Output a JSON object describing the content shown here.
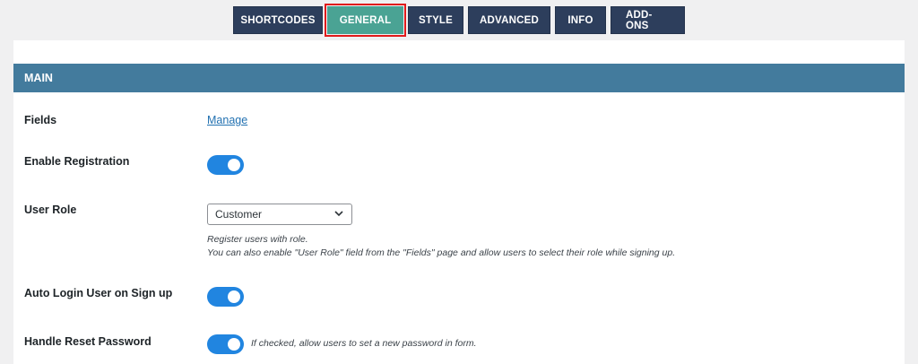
{
  "tabs": [
    {
      "label": "SHORTCODES"
    },
    {
      "label": "GENERAL"
    },
    {
      "label": "STYLE"
    },
    {
      "label": "ADVANCED"
    },
    {
      "label": "INFO"
    },
    {
      "label": "ADD-ONS"
    }
  ],
  "active_tab": "GENERAL",
  "section": {
    "title": "MAIN"
  },
  "fields": {
    "label": "Fields",
    "link": "Manage"
  },
  "enable_registration": {
    "label": "Enable Registration",
    "checked": true
  },
  "user_role": {
    "label": "User Role",
    "selected": "Customer",
    "description_line1": "Register users with role.",
    "description_line2": "You can also enable \"User Role\" field from the \"Fields\" page and allow users to select their role while signing up."
  },
  "auto_login": {
    "label": "Auto Login User on Sign up",
    "checked": true
  },
  "reset_password": {
    "label": "Handle Reset Password",
    "checked": true,
    "description": "If checked, allow users to set a new password in form."
  },
  "colors": {
    "tab_bg": "#2d3e5c",
    "tab_active_bg": "#4aa394",
    "highlight_outline": "#e01b1b",
    "section_header_bg": "#437b9d",
    "toggle_on": "#2185e0",
    "link": "#2271b1"
  },
  "icons": {
    "select_chevron": "chevron-down-icon"
  }
}
